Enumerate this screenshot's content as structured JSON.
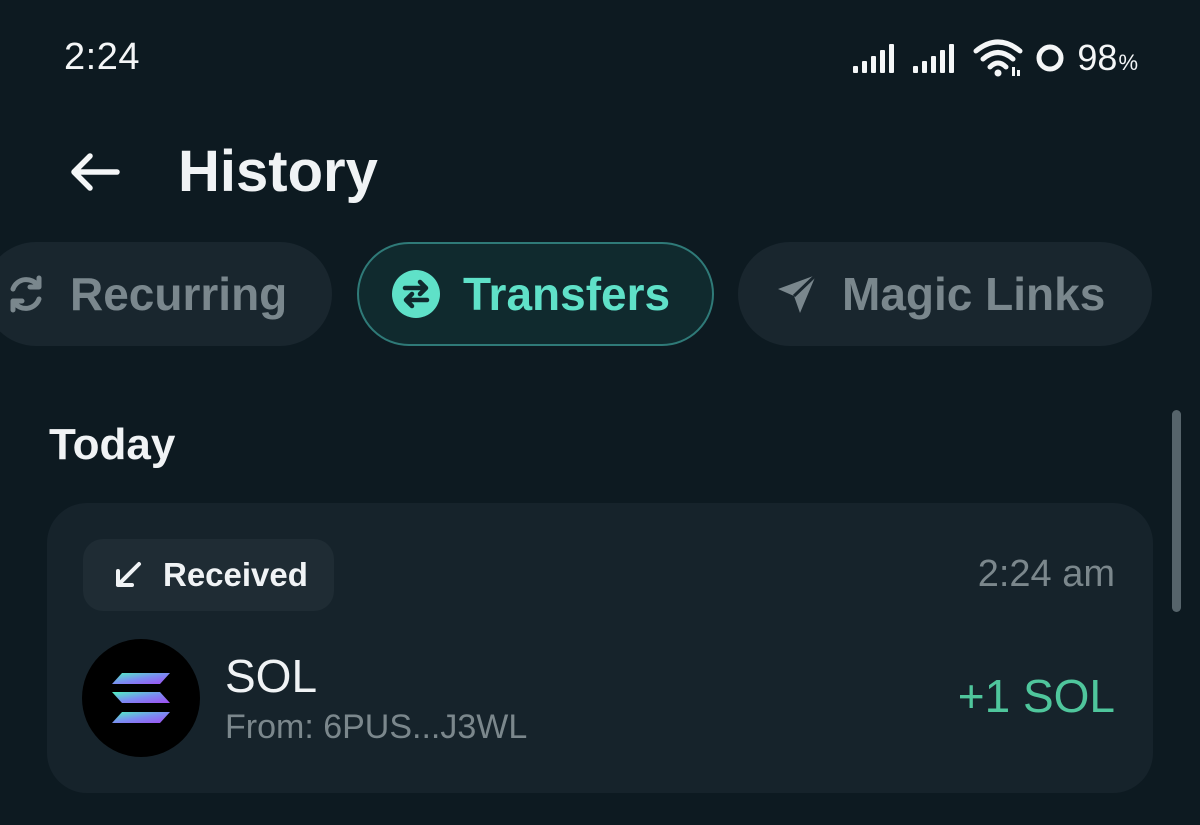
{
  "status_bar": {
    "time": "2:24",
    "battery_value": "98",
    "battery_unit": "%",
    "icons": [
      "signal-icon",
      "signal-icon",
      "wifi-icon",
      "battery-ring-icon"
    ]
  },
  "header": {
    "back_icon": "arrow-left-icon",
    "title": "History"
  },
  "tabs": [
    {
      "label": "Recurring",
      "icon": "recurring-icon",
      "active": false
    },
    {
      "label": "Transfers",
      "icon": "transfer-icon",
      "active": true
    },
    {
      "label": "Magic Links",
      "icon": "send-arrow-icon",
      "active": false
    }
  ],
  "section": {
    "title": "Today"
  },
  "transactions": [
    {
      "type_label": "Received",
      "type_icon": "arrow-down-left-icon",
      "time": "2:24 am",
      "token": "SOL",
      "from": "From: 6PUS...J3WL",
      "amount": "+1 SOL",
      "token_icon": "solana-logo-icon"
    }
  ],
  "colors": {
    "background": "#0d1a21",
    "card": "#16232b",
    "accent": "#5fe1c8",
    "accent_border": "#2f7a78",
    "positive": "#4fc69c",
    "muted_text": "#7b878c"
  }
}
